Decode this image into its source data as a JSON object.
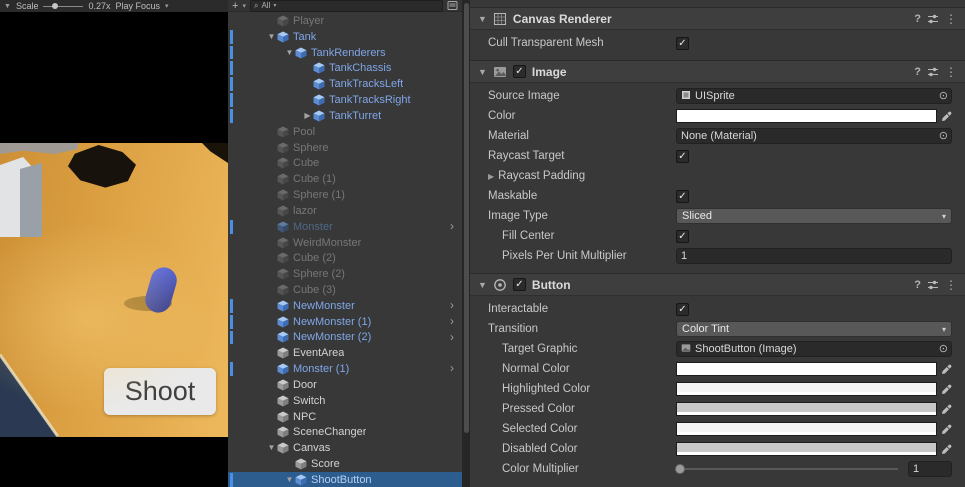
{
  "game_view": {
    "toolbar": {
      "scale_label": "Scale",
      "scale_value": "0.27x",
      "play_focus_label": "Play Focus"
    },
    "shoot_button_label": "Shoot",
    "scene_colors": {
      "sand": "#DDA244",
      "sand_highlight": "#F0BD63",
      "capsule_blue": "#3D4CC0",
      "corner_navy": "#2B3A52"
    }
  },
  "hierarchy": {
    "toolbar": {
      "create_label": "+",
      "search_filter_label": "All"
    },
    "selection_color": "#2D5C8E",
    "prefab_text_color": "#7FA6E8",
    "items": [
      {
        "label": "Player",
        "depth": 1,
        "kind": "inactive",
        "expander": "none",
        "nav_arrow": false,
        "blue_bar": false,
        "selected": false
      },
      {
        "label": "Tank",
        "depth": 1,
        "kind": "prefab",
        "expander": "open",
        "nav_arrow": false,
        "blue_bar": true,
        "selected": false
      },
      {
        "label": "TankRenderers",
        "depth": 2,
        "kind": "prefab",
        "expander": "open",
        "nav_arrow": false,
        "blue_bar": true,
        "selected": false
      },
      {
        "label": "TankChassis",
        "depth": 3,
        "kind": "prefab",
        "expander": "none",
        "nav_arrow": false,
        "blue_bar": true,
        "selected": false
      },
      {
        "label": "TankTracksLeft",
        "depth": 3,
        "kind": "prefab",
        "expander": "none",
        "nav_arrow": false,
        "blue_bar": true,
        "selected": false
      },
      {
        "label": "TankTracksRight",
        "depth": 3,
        "kind": "prefab",
        "expander": "none",
        "nav_arrow": false,
        "blue_bar": true,
        "selected": false
      },
      {
        "label": "TankTurret",
        "depth": 3,
        "kind": "prefab",
        "expander": "closed",
        "nav_arrow": false,
        "blue_bar": true,
        "selected": false
      },
      {
        "label": "Pool",
        "depth": 1,
        "kind": "inactive",
        "expander": "none",
        "nav_arrow": false,
        "blue_bar": false,
        "selected": false
      },
      {
        "label": "Sphere",
        "depth": 1,
        "kind": "inactive",
        "expander": "none",
        "nav_arrow": false,
        "blue_bar": false,
        "selected": false
      },
      {
        "label": "Cube",
        "depth": 1,
        "kind": "inactive",
        "expander": "none",
        "nav_arrow": false,
        "blue_bar": false,
        "selected": false
      },
      {
        "label": "Cube (1)",
        "depth": 1,
        "kind": "inactive",
        "expander": "none",
        "nav_arrow": false,
        "blue_bar": false,
        "selected": false
      },
      {
        "label": "Sphere (1)",
        "depth": 1,
        "kind": "inactive",
        "expander": "none",
        "nav_arrow": false,
        "blue_bar": false,
        "selected": false
      },
      {
        "label": "lazor",
        "depth": 1,
        "kind": "inactive",
        "expander": "none",
        "nav_arrow": false,
        "blue_bar": false,
        "selected": false
      },
      {
        "label": "Monster",
        "depth": 1,
        "kind": "prefab-inactive",
        "expander": "none",
        "nav_arrow": true,
        "blue_bar": true,
        "selected": false
      },
      {
        "label": "WeirdMonster",
        "depth": 1,
        "kind": "inactive",
        "expander": "none",
        "nav_arrow": false,
        "blue_bar": false,
        "selected": false
      },
      {
        "label": "Cube (2)",
        "depth": 1,
        "kind": "inactive",
        "expander": "none",
        "nav_arrow": false,
        "blue_bar": false,
        "selected": false
      },
      {
        "label": "Sphere (2)",
        "depth": 1,
        "kind": "inactive",
        "expander": "none",
        "nav_arrow": false,
        "blue_bar": false,
        "selected": false
      },
      {
        "label": "Cube (3)",
        "depth": 1,
        "kind": "inactive",
        "expander": "none",
        "nav_arrow": false,
        "blue_bar": false,
        "selected": false
      },
      {
        "label": "NewMonster",
        "depth": 1,
        "kind": "prefab",
        "expander": "none",
        "nav_arrow": true,
        "blue_bar": true,
        "selected": false
      },
      {
        "label": "NewMonster (1)",
        "depth": 1,
        "kind": "prefab",
        "expander": "none",
        "nav_arrow": true,
        "blue_bar": true,
        "selected": false
      },
      {
        "label": "NewMonster (2)",
        "depth": 1,
        "kind": "prefab",
        "expander": "none",
        "nav_arrow": true,
        "blue_bar": true,
        "selected": false
      },
      {
        "label": "EventArea",
        "depth": 1,
        "kind": "normal",
        "expander": "none",
        "nav_arrow": false,
        "blue_bar": false,
        "selected": false
      },
      {
        "label": "Monster (1)",
        "depth": 1,
        "kind": "prefab",
        "expander": "none",
        "nav_arrow": true,
        "blue_bar": true,
        "selected": false
      },
      {
        "label": "Door",
        "depth": 1,
        "kind": "normal",
        "expander": "none",
        "nav_arrow": false,
        "blue_bar": false,
        "selected": false
      },
      {
        "label": "Switch",
        "depth": 1,
        "kind": "normal",
        "expander": "none",
        "nav_arrow": false,
        "blue_bar": false,
        "selected": false
      },
      {
        "label": "NPC",
        "depth": 1,
        "kind": "normal",
        "expander": "none",
        "nav_arrow": false,
        "blue_bar": false,
        "selected": false
      },
      {
        "label": "SceneChanger",
        "depth": 1,
        "kind": "normal",
        "expander": "none",
        "nav_arrow": false,
        "blue_bar": false,
        "selected": false
      },
      {
        "label": "Canvas",
        "depth": 1,
        "kind": "normal",
        "expander": "open",
        "nav_arrow": false,
        "blue_bar": false,
        "selected": false
      },
      {
        "label": "Score",
        "depth": 2,
        "kind": "normal",
        "expander": "none",
        "nav_arrow": false,
        "blue_bar": false,
        "selected": false
      },
      {
        "label": "ShootButton",
        "depth": 2,
        "kind": "prefab",
        "expander": "open",
        "nav_arrow": false,
        "blue_bar": true,
        "selected": true
      }
    ]
  },
  "inspector": {
    "components": [
      {
        "name": "Canvas Renderer",
        "icon": "canvas-renderer",
        "enabled": null,
        "rows": [
          {
            "label": "Cull Transparent Mesh",
            "type": "checkbox",
            "value": true,
            "indent": 0
          }
        ]
      },
      {
        "name": "Image",
        "icon": "image",
        "enabled": true,
        "rows": [
          {
            "label": "Source Image",
            "type": "object",
            "value": "UISprite",
            "obj_icon": "sprite",
            "indent": 0
          },
          {
            "label": "Color",
            "type": "color",
            "value": "#FFFFFF",
            "indent": 0
          },
          {
            "label": "Material",
            "type": "object",
            "value": "None (Material)",
            "obj_icon": "none",
            "indent": 0
          },
          {
            "label": "Raycast Target",
            "type": "checkbox",
            "value": true,
            "indent": 0
          },
          {
            "label": "Raycast Padding",
            "type": "foldout",
            "indent": 0
          },
          {
            "label": "Maskable",
            "type": "checkbox",
            "value": true,
            "indent": 0
          },
          {
            "label": "Image Type",
            "type": "dropdown",
            "value": "Sliced",
            "indent": 0
          },
          {
            "label": "Fill Center",
            "type": "checkbox",
            "value": true,
            "indent": 1
          },
          {
            "label": "Pixels Per Unit Multiplier",
            "type": "number",
            "value": "1",
            "indent": 1
          }
        ]
      },
      {
        "name": "Button",
        "icon": "button",
        "enabled": true,
        "rows": [
          {
            "label": "Interactable",
            "type": "checkbox",
            "value": true,
            "indent": 0
          },
          {
            "label": "Transition",
            "type": "dropdown",
            "value": "Color Tint",
            "indent": 0
          },
          {
            "label": "Target Graphic",
            "type": "object",
            "value": "ShootButton (Image)",
            "obj_icon": "image",
            "indent": 1
          },
          {
            "label": "Normal Color",
            "type": "color",
            "value": "#FFFFFF",
            "indent": 1
          },
          {
            "label": "Highlighted Color",
            "type": "color",
            "value": "#F5F5F5",
            "indent": 1
          },
          {
            "label": "Pressed Color",
            "type": "color",
            "value": "#C8C8C8",
            "indent": 1
          },
          {
            "label": "Selected Color",
            "type": "color",
            "value": "#F5F5F5",
            "indent": 1
          },
          {
            "label": "Disabled Color",
            "type": "color",
            "value": "#C8C8C8",
            "indent": 1
          },
          {
            "label": "Color Multiplier",
            "type": "slider",
            "value": "1",
            "slider_pos": 0,
            "indent": 1
          }
        ]
      }
    ]
  },
  "glyphs": {
    "foldout_open": "▼",
    "foldout_closed": "▶",
    "nav_arrow": "›",
    "caret_down": "▾",
    "check": "✓",
    "object_picker": "⊙",
    "menu_kebab": "⋮",
    "help": "?",
    "search": "⌕",
    "plus": "+"
  }
}
